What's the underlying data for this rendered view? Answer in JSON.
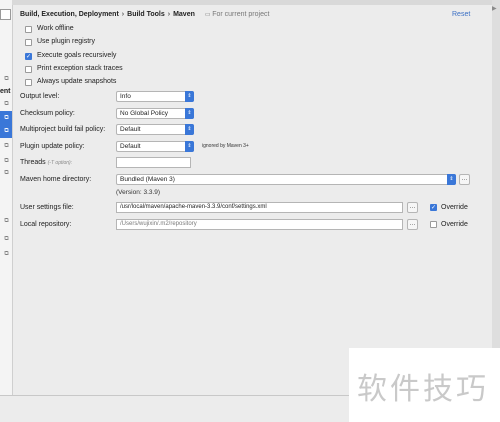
{
  "breadcrumb": {
    "part1": "Build, Execution, Deployment",
    "part2": "Build Tools",
    "part3": "Maven",
    "scope": "For current project"
  },
  "reset_label": "Reset",
  "left_panel": {
    "partial_label": "ent"
  },
  "options": {
    "work_offline": {
      "label": "Work offline",
      "checked": false
    },
    "use_plugin_registry": {
      "label": "Use plugin registry",
      "checked": false
    },
    "execute_goals_recursively": {
      "label": "Execute goals recursively",
      "checked": true
    },
    "print_exception_stack_traces": {
      "label": "Print exception stack traces",
      "checked": false
    },
    "always_update_snapshots": {
      "label": "Always update snapshots",
      "checked": false
    }
  },
  "output_level": {
    "label": "Output level:",
    "value": "Info"
  },
  "checksum_policy": {
    "label": "Checksum policy:",
    "value": "No Global Policy"
  },
  "multiproject_fail_policy": {
    "label": "Multiproject build fail policy:",
    "value": "Default"
  },
  "plugin_update_policy": {
    "label": "Plugin update policy:",
    "value": "Default",
    "note": "ignored by Maven 3+"
  },
  "threads": {
    "label": "Threads",
    "hint": "(-T option):",
    "value": ""
  },
  "maven_home": {
    "label": "Maven home directory:",
    "value": "Bundled (Maven 3)",
    "version": "(Version: 3.3.9)"
  },
  "user_settings": {
    "label": "User settings file:",
    "value": "/usr/local/maven/apache-maven-3.3.9/conf/settings.xml",
    "override_label": "Override",
    "override_checked": true
  },
  "local_repo": {
    "label": "Local repository:",
    "value": "/Users/wujixin/.m2/repository",
    "override_label": "Override",
    "override_checked": false
  },
  "watermark": "软件技巧",
  "colors": {
    "accent": "#3a77d8",
    "link": "#3a6fc4",
    "background": "#ececec"
  }
}
